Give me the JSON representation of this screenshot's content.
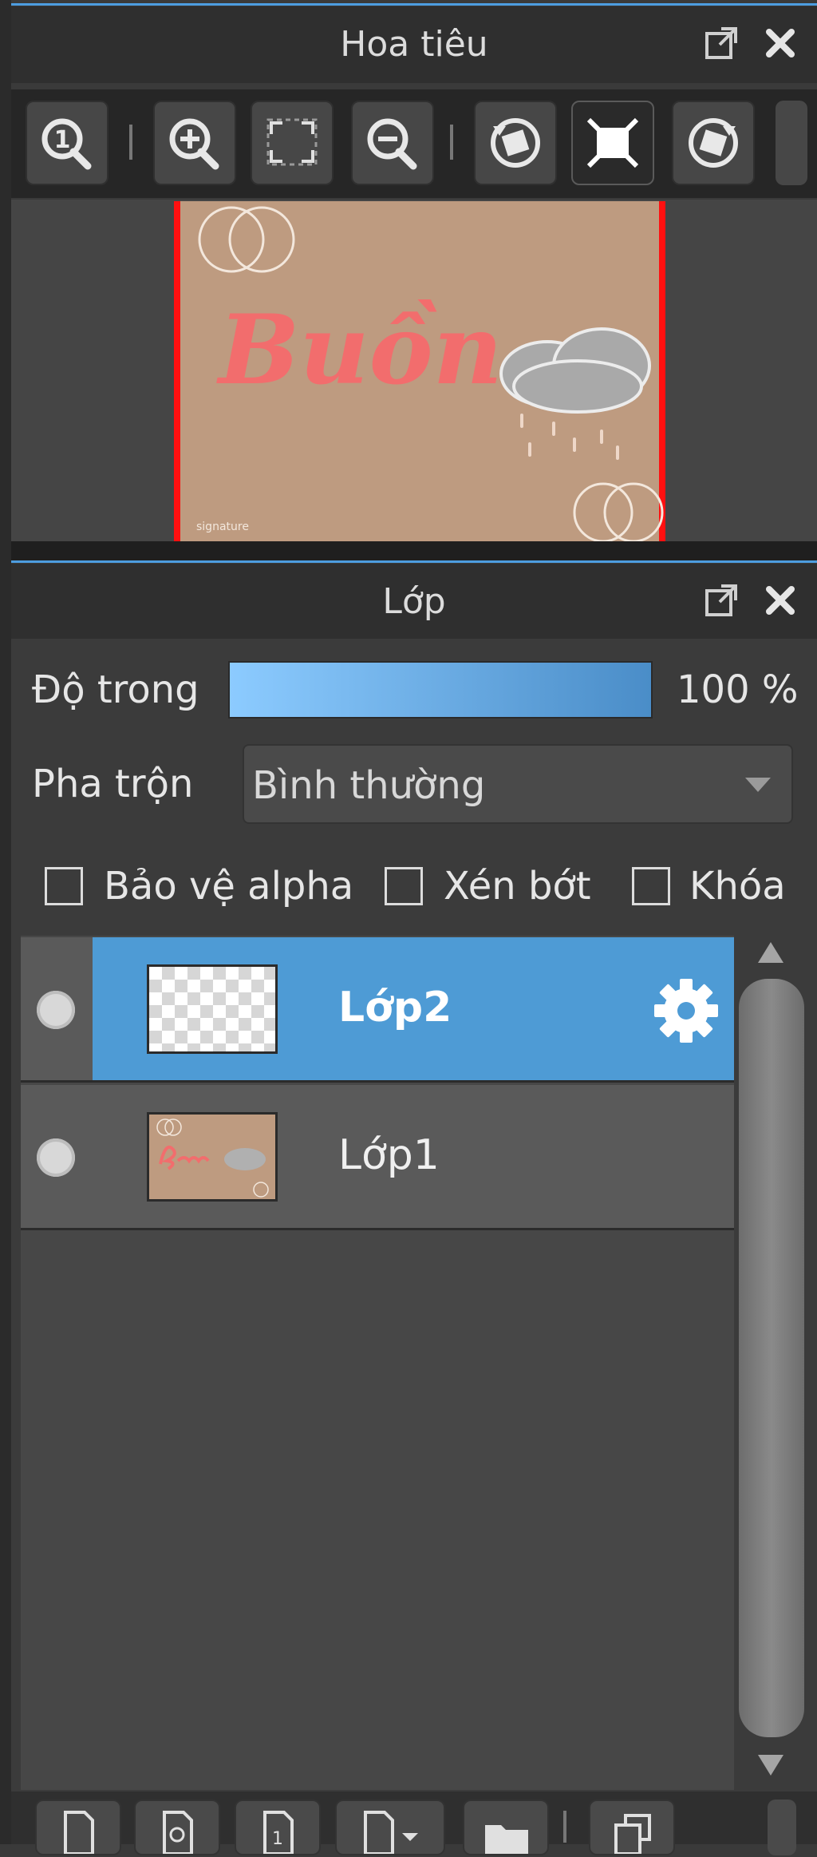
{
  "navigator": {
    "title": "Hoa tiêu",
    "toolbar": [
      {
        "name": "zoom-actual-size",
        "icon": "zoom-one-icon"
      },
      {
        "name": "zoom-in",
        "icon": "zoom-in-icon"
      },
      {
        "name": "fit-window",
        "icon": "fit-screen-icon"
      },
      {
        "name": "zoom-out",
        "icon": "zoom-out-icon"
      },
      {
        "name": "rotate-left",
        "icon": "rotate-left-icon"
      },
      {
        "name": "fit-canvas",
        "icon": "fit-canvas-icon",
        "active": true
      },
      {
        "name": "rotate-right",
        "icon": "rotate-right-icon"
      }
    ],
    "preview_text": "Buồn"
  },
  "layers": {
    "title": "Lớp",
    "opacity_label": "Độ trong",
    "opacity_value": "100 %",
    "opacity_level": 1.0,
    "blend_label": "Pha trộn",
    "blend_value": "Bình thường",
    "checkboxes": [
      {
        "label": "Bảo vệ alpha",
        "checked": false
      },
      {
        "label": "Xén bớt",
        "checked": false
      },
      {
        "label": "Khóa",
        "checked": false
      }
    ],
    "items": [
      {
        "name": "Lớp2",
        "selected": true
      },
      {
        "name": "Lớp1",
        "selected": false
      }
    ]
  },
  "colors": {
    "accent": "#4e9bd5",
    "canvas_bg": "#be9b80",
    "canvas_border": "#ff0000",
    "lettering": "#f26d6d"
  }
}
